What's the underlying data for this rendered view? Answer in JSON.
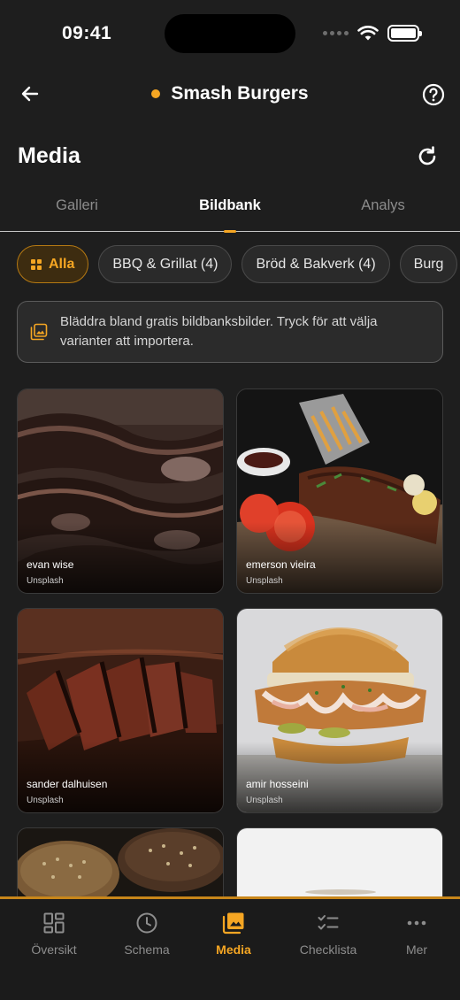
{
  "status_bar": {
    "time": "09:41"
  },
  "nav": {
    "title": "Smash Burgers"
  },
  "header": {
    "title": "Media"
  },
  "tabs": [
    {
      "label": "Galleri",
      "active": false
    },
    {
      "label": "Bildbank",
      "active": true
    },
    {
      "label": "Analys",
      "active": false
    }
  ],
  "filters": [
    {
      "label": "Alla",
      "active": true
    },
    {
      "label": "BBQ & Grillat (4)",
      "active": false
    },
    {
      "label": "Bröd & Bakverk (4)",
      "active": false
    },
    {
      "label": "Burg",
      "active": false
    }
  ],
  "info_banner": {
    "text": "Bläddra bland gratis bildbanksbilder. Tryck för att välja varianter att importera."
  },
  "photos": [
    {
      "author": "evan wise",
      "source": "Unsplash",
      "subject": "grilled ribs"
    },
    {
      "author": "emerson vieira",
      "source": "Unsplash",
      "subject": "ribs with fries"
    },
    {
      "author": "sander dalhuisen",
      "source": "Unsplash",
      "subject": "sliced steak"
    },
    {
      "author": "amir hosseini",
      "source": "Unsplash",
      "subject": "fried chicken burger"
    },
    {
      "author": "",
      "source": "",
      "subject": "bread loaves"
    },
    {
      "author": "",
      "source": "",
      "subject": "plain background"
    }
  ],
  "bottom_nav": [
    {
      "label": "Översikt",
      "icon": "dashboard-icon",
      "active": false
    },
    {
      "label": "Schema",
      "icon": "clock-icon",
      "active": false
    },
    {
      "label": "Media",
      "icon": "image-stack-icon",
      "active": true
    },
    {
      "label": "Checklista",
      "icon": "checklist-icon",
      "active": false
    },
    {
      "label": "Mer",
      "icon": "more-dots-icon",
      "active": false
    }
  ],
  "colors": {
    "accent": "#f5a623",
    "background": "#1e1e1e",
    "inactive": "#8d8d8d"
  }
}
